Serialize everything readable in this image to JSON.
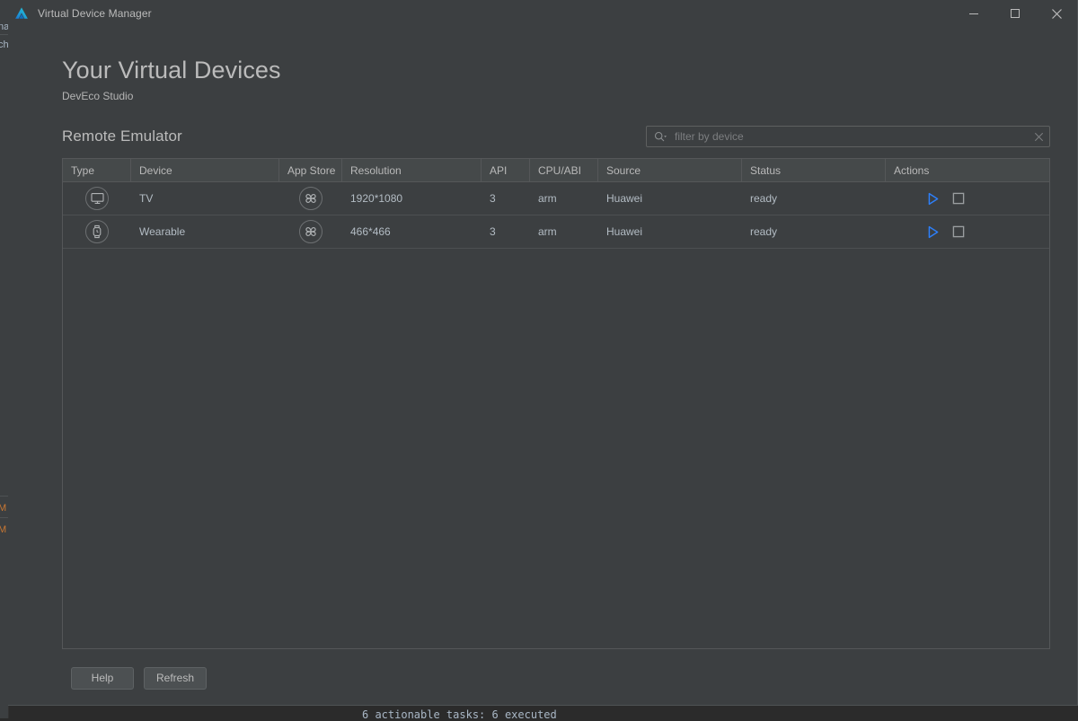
{
  "window": {
    "title": "Virtual Device Manager",
    "logo_icon": "deveco-logo-icon",
    "controls": {
      "minimize": "minimize-icon",
      "maximize": "maximize-icon",
      "close": "close-icon"
    }
  },
  "header": {
    "title": "Your Virtual Devices",
    "subtitle": "DevEco Studio"
  },
  "section": {
    "title": "Remote Emulator"
  },
  "search": {
    "placeholder": "filter by device",
    "value": "",
    "search_icon": "search-dropdown-icon",
    "clear_icon": "clear-icon"
  },
  "table": {
    "columns": [
      {
        "key": "type",
        "label": "Type"
      },
      {
        "key": "device",
        "label": "Device"
      },
      {
        "key": "app_store",
        "label": "App Store"
      },
      {
        "key": "resolution",
        "label": "Resolution"
      },
      {
        "key": "api",
        "label": "API"
      },
      {
        "key": "cpu_abi",
        "label": "CPU/ABI"
      },
      {
        "key": "source",
        "label": "Source"
      },
      {
        "key": "status",
        "label": "Status"
      },
      {
        "key": "actions",
        "label": "Actions"
      }
    ],
    "rows": [
      {
        "type_icon": "tv-monitor-icon",
        "device": "TV",
        "app_store_icon": "app-gallery-icon",
        "resolution": "1920*1080",
        "api": "3",
        "cpu_abi": "arm",
        "source": "Huawei",
        "status": "ready",
        "actions": {
          "run_icon": "play-icon",
          "stop_icon": "stop-icon"
        }
      },
      {
        "type_icon": "wearable-watch-icon",
        "device": "Wearable",
        "app_store_icon": "app-gallery-icon",
        "resolution": "466*466",
        "api": "3",
        "cpu_abi": "arm",
        "source": "Huawei",
        "status": "ready",
        "actions": {
          "run_icon": "play-icon",
          "stop_icon": "stop-icon"
        }
      }
    ]
  },
  "footer": {
    "help_label": "Help",
    "refresh_label": "Refresh"
  },
  "background": {
    "console_text": "6 actionable tasks: 6 executed",
    "left_fragments": [
      "na",
      "ch",
      "M",
      "M"
    ]
  },
  "colors": {
    "window_bg": "#3c3f41",
    "header_row_bg": "#45494a",
    "text_primary": "#bbbbbb",
    "text_cell": "#b3bcc4",
    "accent_blue": "#2d7ff9",
    "border": "#555759",
    "logo_blue": "#2196f3",
    "logo_teal": "#1ec8c8"
  }
}
